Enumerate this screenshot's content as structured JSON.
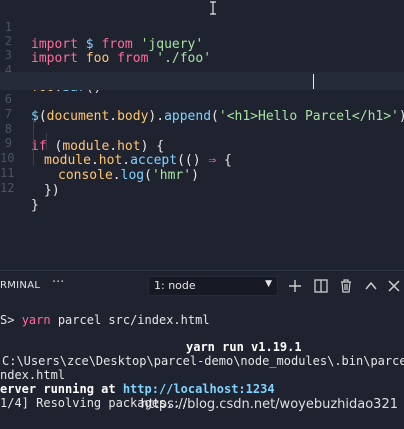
{
  "editor": {
    "lines": [
      {
        "no": "1"
      },
      {
        "no": "2"
      },
      {
        "no": "3"
      },
      {
        "no": "4"
      },
      {
        "no": "5"
      },
      {
        "no": "6"
      },
      {
        "no": "7"
      },
      {
        "no": "8"
      },
      {
        "no": "9"
      },
      {
        "no": "10"
      },
      {
        "no": "11"
      },
      {
        "no": "12"
      }
    ],
    "tokens": {
      "l1": [
        "import",
        " ",
        "$",
        " ",
        "from",
        " ",
        "'jquery'"
      ],
      "l2": [
        "import",
        " ",
        "foo",
        " ",
        "from",
        " ",
        "'./foo'"
      ],
      "l4": [
        "foo",
        ".",
        "bar",
        "()"
      ],
      "l6": [
        "$",
        "(",
        "document",
        ".",
        "body",
        ").",
        "append",
        "(",
        "'<h1>Hello Parcel</h1>'",
        ")"
      ],
      "l8": [
        "if",
        " (",
        "module",
        ".",
        "hot",
        ") {"
      ],
      "l9": [
        "module",
        ".",
        "hot",
        ".",
        "accept",
        "(() ",
        "⇒",
        " {"
      ],
      "l10": [
        "console",
        ".",
        "log",
        "(",
        "'hmr'",
        ")"
      ],
      "l11": [
        "})"
      ],
      "l12": [
        "}"
      ]
    }
  },
  "panel": {
    "tab_label": "RMINAL",
    "more_label": "···",
    "terminal_select": "1: node",
    "select_caret": "▼",
    "icons": [
      "plus-icon",
      "split-terminal-icon",
      "trash-icon",
      "chevron-up-icon",
      "close-icon"
    ]
  },
  "terminal": {
    "prompt": "S>",
    "command": "yarn",
    "args": "parcel src/index.html",
    "yarn_run": "yarn run v1.19.1",
    "path_line_1": "C:\\Users\\zce\\Desktop\\parcel-demo\\node_modules\\.bin\\parcel src/",
    "path_line_2": "ndex.html",
    "server_label": "erver running at",
    "server_url": "http://localhost:1234",
    "resolving": "1/4] Resolving packages..."
  },
  "watermark": "https://blog.csdn.net/woyebuzhidao321",
  "colors": {
    "background": "#1f2330",
    "keyword": "#ff6b9a",
    "string": "#a6e3a1",
    "function": "#7fd3ff",
    "identifier": "#ffc66d"
  }
}
